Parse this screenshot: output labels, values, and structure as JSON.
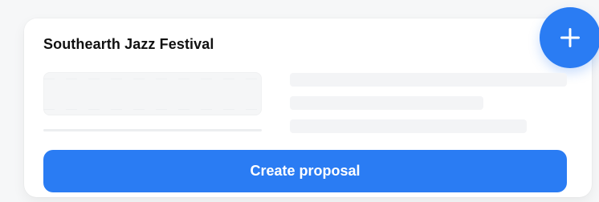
{
  "card": {
    "title": "Southearth Jazz Festival",
    "add_icon": "plus-icon",
    "create_button_label": "Create proposal"
  },
  "colors": {
    "accent": "#2a7cf3",
    "skeleton": "#f3f4f6",
    "title": "#111111",
    "card_background": "#ffffff",
    "page_background": "#f6f7f8"
  }
}
